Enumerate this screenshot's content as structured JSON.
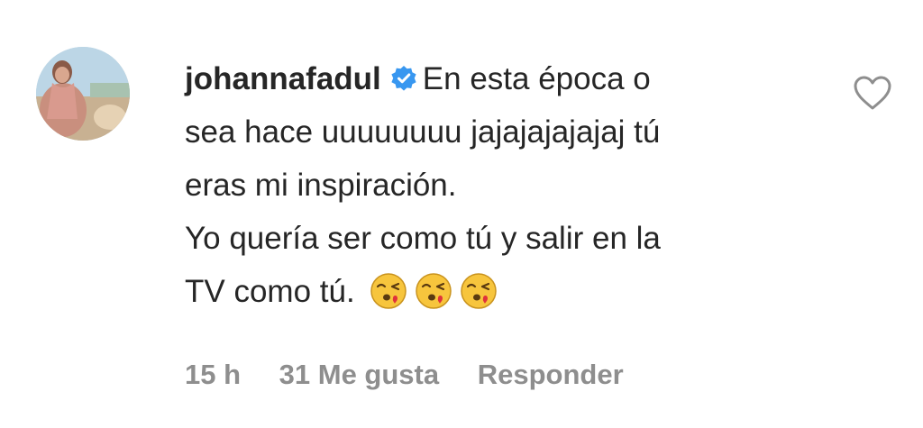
{
  "comment": {
    "username": "johannafadul",
    "verified": true,
    "lines": [
      "En esta época o",
      "sea hace uuuuuuuu jajajajajajaj tú",
      "eras mi inspiración.",
      "Yo quería ser como tú y salir en la",
      "TV como tú."
    ],
    "emojis": [
      "face-blowing-a-kiss-emoji",
      "face-blowing-a-kiss-emoji",
      "face-blowing-a-kiss-emoji"
    ],
    "time": "15 h",
    "likes": "31 Me gusta",
    "reply_label": "Responder"
  },
  "colors": {
    "text": "#262626",
    "meta": "#8e8e8e",
    "verified": "#3897f0",
    "heart_outline": "#8e8e8e",
    "emoji_face": "#f7c53d",
    "emoji_kiss": "#e0323b"
  },
  "icons": {
    "verified": "verified-badge-icon",
    "like": "heart-outline-icon"
  }
}
